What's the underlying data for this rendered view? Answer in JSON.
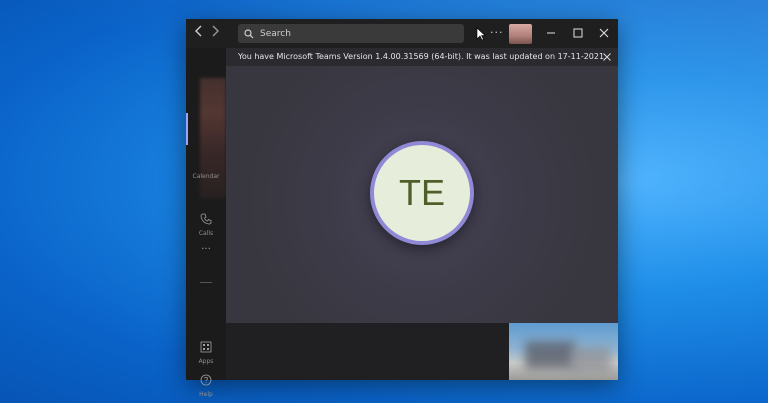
{
  "window": {
    "search_placeholder": "Search",
    "more_label": "···"
  },
  "sidebar": {
    "items": [
      {
        "label": "Calendar",
        "icon": "calendar-icon"
      },
      {
        "label": "Calls",
        "icon": "phone-icon"
      },
      {
        "label": "···",
        "icon": "more-icon"
      },
      {
        "label": "Apps",
        "icon": "apps-icon"
      },
      {
        "label": "Help",
        "icon": "help-icon"
      }
    ]
  },
  "banner": {
    "text": "You have Microsoft Teams Version 1.4.00.31569 (64-bit). It was last updated on 17-11-2021."
  },
  "call": {
    "avatar_initials": "TE"
  },
  "colors": {
    "accent": "#9ea2ff",
    "avatar_bg": "#e6eedb",
    "avatar_text": "#4f5f2a"
  }
}
